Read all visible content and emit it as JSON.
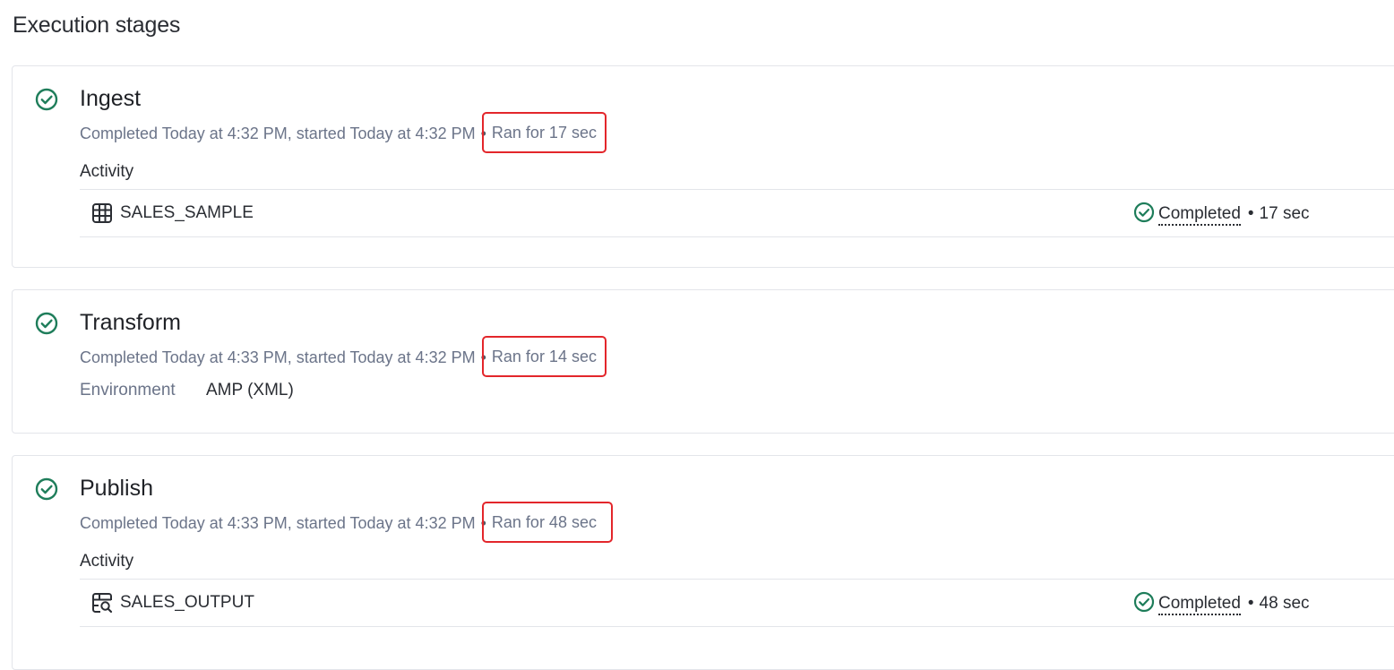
{
  "page": {
    "title": "Execution stages"
  },
  "stages": [
    {
      "name": "Ingest",
      "icon": "check-circle-icon",
      "completed_text": "Completed Today at 4:32 PM, started Today at 4:32 PM",
      "separator": "•",
      "ran_for": "Ran for 17 sec",
      "section_label": "Activity",
      "activity": {
        "icon": "table-icon",
        "name": "SALES_SAMPLE",
        "status_icon": "check-circle-icon",
        "status": "Completed",
        "separator": "•",
        "duration": "17 sec"
      }
    },
    {
      "name": "Transform",
      "icon": "check-circle-icon",
      "completed_text": "Completed Today at 4:33 PM, started Today at 4:32 PM",
      "separator": "•",
      "ran_for": "Ran for 14 sec",
      "environment_label": "Environment",
      "environment_value": "AMP (XML)"
    },
    {
      "name": "Publish",
      "icon": "check-circle-icon",
      "completed_text": "Completed Today at 4:33 PM, started Today at 4:32 PM",
      "separator": "•",
      "ran_for": "Ran for 48 sec",
      "section_label": "Activity",
      "activity": {
        "icon": "dataset-search-icon",
        "name": "SALES_OUTPUT",
        "status_icon": "check-circle-icon",
        "status": "Completed",
        "separator": "•",
        "duration": "48 sec"
      }
    }
  ],
  "colors": {
    "success": "#1e7d5a",
    "muted_text": "#6b7489",
    "highlight_box": "#e3262b",
    "border": "#e3e5ea"
  }
}
